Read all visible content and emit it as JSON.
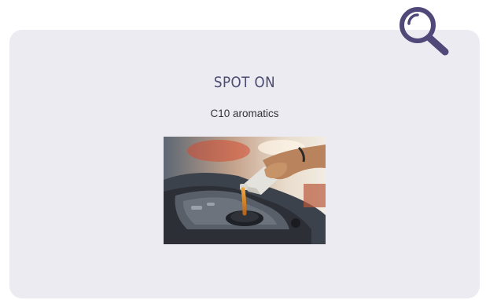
{
  "card": {
    "title": "SPOT ON",
    "subtitle": "C10 aromatics",
    "image_icon": "engine-oil-pour-photo"
  },
  "search": {
    "icon": "search-icon",
    "color": "#4f4879"
  },
  "colors": {
    "card_bg": "#ebebf1",
    "title": "#4b4b72"
  }
}
